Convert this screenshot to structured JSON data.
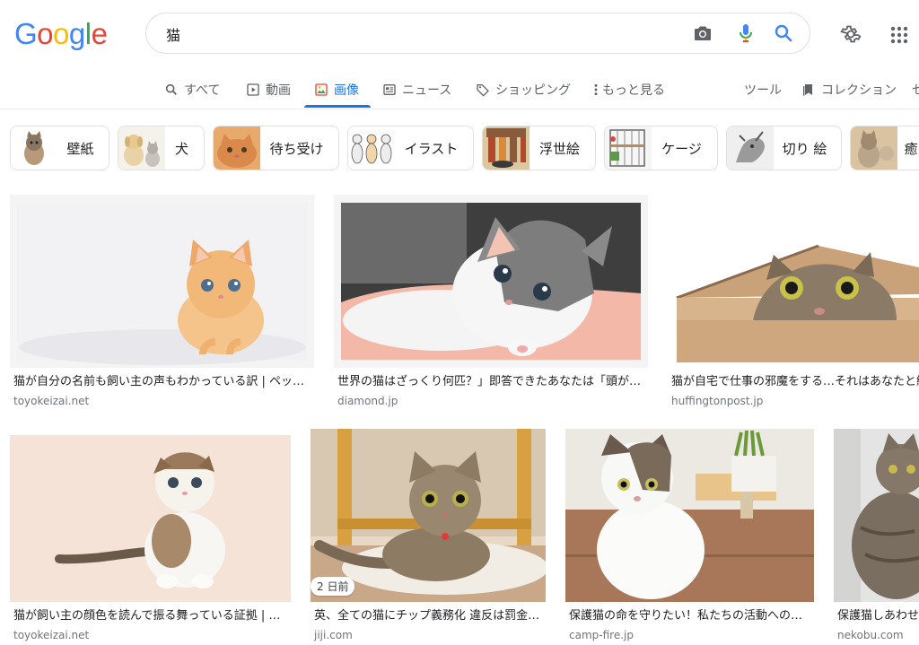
{
  "logo": {
    "text": [
      "G",
      "o",
      "o",
      "g",
      "l",
      "e"
    ]
  },
  "search": {
    "value": "猫"
  },
  "icons": {
    "camera": "camera-icon",
    "mic": "mic-icon",
    "search": "search-icon",
    "settings": "gear-icon",
    "apps": "apps-grid-icon"
  },
  "tabs": [
    {
      "label": "すべて",
      "icon": "search-icon"
    },
    {
      "label": "動画",
      "icon": "play-icon"
    },
    {
      "label": "画像",
      "icon": "image-icon",
      "active": true
    },
    {
      "label": "ニュース",
      "icon": "news-icon"
    },
    {
      "label": "ショッピング",
      "icon": "tag-icon"
    },
    {
      "label": "もっと見る",
      "icon": "more-vert-icon"
    },
    {
      "label": "ツール"
    },
    {
      "label": "コレクション",
      "icon": "bookmark-icon"
    },
    {
      "label": "セ"
    }
  ],
  "chips": [
    {
      "label": "壁紙"
    },
    {
      "label": "犬"
    },
    {
      "label": "待ち受け"
    },
    {
      "label": "イラスト"
    },
    {
      "label": "浮世絵"
    },
    {
      "label": "ケージ"
    },
    {
      "label": "切り 絵"
    },
    {
      "label": "癒"
    }
  ],
  "results": [
    {
      "caption": "猫が自分の名前も飼い主の声もわかっている訳 | ペッ…",
      "source": "toyokeizai.net"
    },
    {
      "caption": "世界の猫はざっくり何匹？」即答できたあなたは「頭が…",
      "source": "diamond.jp"
    },
    {
      "caption": "猫が自宅で仕事の邪魔をする…それはあなたと継",
      "source": "huffingtonpost.jp"
    },
    {
      "caption": "猫が飼い主の顔色を読んで振る舞っている証拠 | …",
      "source": "toyokeizai.net"
    },
    {
      "caption": "英、全ての猫にチップ義務化 違反は罰金…",
      "source": "jiji.com",
      "badge": "2 日前"
    },
    {
      "caption": "保護猫の命を守りたい！私たちの活動への…",
      "source": "camp-fire.jp"
    },
    {
      "caption": "保護猫しあわせ",
      "source": "nekobu.com"
    }
  ],
  "colors": {
    "accent": "#1a73e8",
    "text": "#202124",
    "secondary": "#5f6368",
    "google_blue": "#4285F4",
    "google_red": "#EA4335",
    "google_yellow": "#FBBC05",
    "google_green": "#34A853"
  }
}
